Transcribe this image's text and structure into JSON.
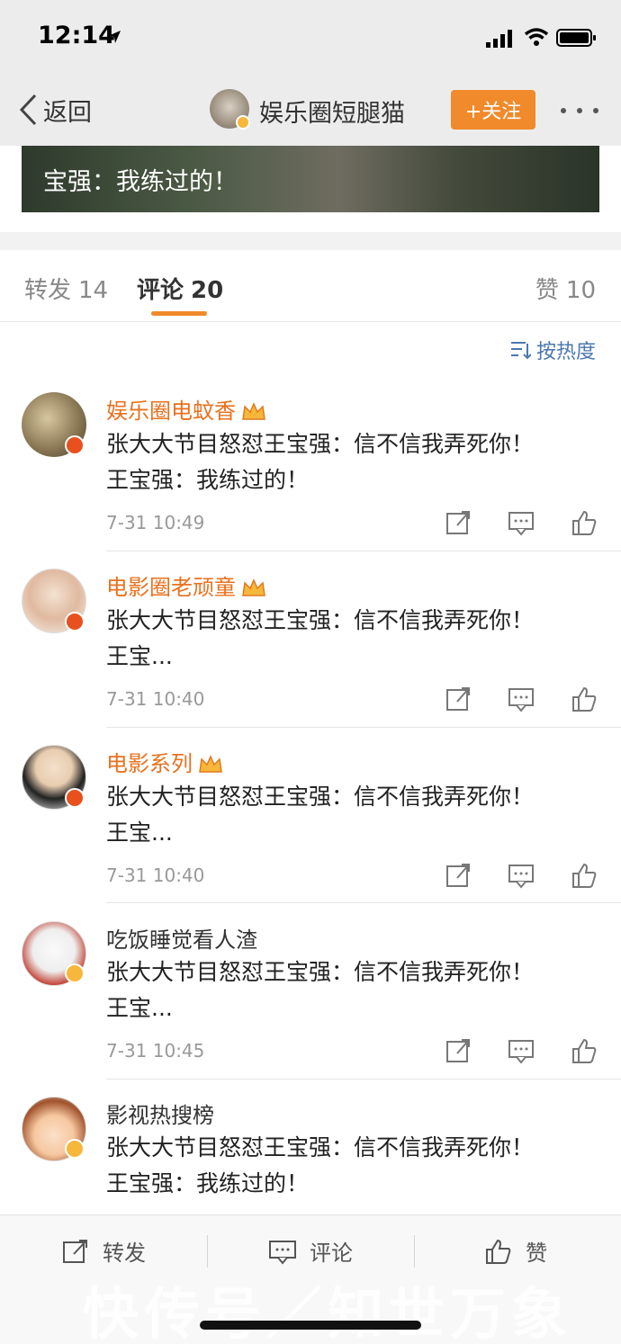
{
  "status_bar": {
    "time": "12:14"
  },
  "nav": {
    "back_label": "返回",
    "title": "娱乐圈短腿猫",
    "follow_label": "+关注"
  },
  "post": {
    "caption_line2": "宝强：我练过的！"
  },
  "tabs": [
    {
      "label": "转发",
      "count": "14"
    },
    {
      "label": "评论",
      "count": "20"
    },
    {
      "label": "赞",
      "count": "10"
    }
  ],
  "sort_label": "按热度",
  "comments": [
    {
      "name": "娱乐圈电蚊香",
      "line1": "张大大节目怒怼王宝强：信不信我弄死你！",
      "line2": "王宝强：我练过的！",
      "time": "7-31 10:49"
    },
    {
      "name": "电影圈老顽童",
      "line1": "张大大节目怒怼王宝强：信不信我弄死你！",
      "line2": "王宝...",
      "time": "7-31 10:40"
    },
    {
      "name": "电影系列",
      "line1": "张大大节目怒怼王宝强：信不信我弄死你！",
      "line2": "王宝...",
      "time": "7-31 10:40"
    },
    {
      "name": "吃饭睡觉看人渣",
      "line1": "张大大节目怒怼王宝强：信不信我弄死你！",
      "line2": "王宝...",
      "time": "7-31 10:45"
    },
    {
      "name": "影视热搜榜",
      "line1": "张大大节目怒怼王宝强：信不信我弄死你！",
      "line2": "王宝强：我练过的！"
    }
  ],
  "bottom_bar": {
    "repost_label": "转发",
    "comment_label": "评论",
    "like_label": "赞"
  },
  "watermark": "快传号／知世万象",
  "colors": {
    "accent": "#f08a2b",
    "vip_name": "#e8711e",
    "link_blue": "#4a78b0"
  }
}
